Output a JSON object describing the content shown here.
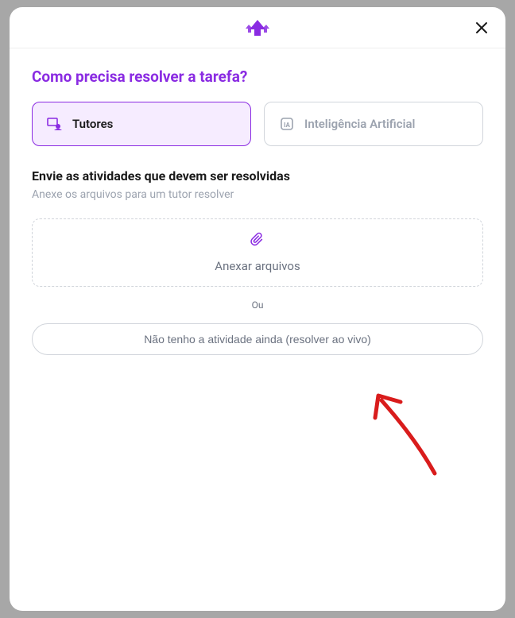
{
  "header": {
    "question": "Como precisa resolver a tarefa?"
  },
  "options": {
    "tutors": {
      "label": "Tutores"
    },
    "ai": {
      "label": "Inteligência Artificial"
    }
  },
  "upload": {
    "title": "Envie as atividades que devem ser resolvidas",
    "subtitle": "Anexe os arquivos para um tutor resolver",
    "dropzone_label": "Anexar arquivos"
  },
  "separator": {
    "label": "Ou"
  },
  "alt_button": {
    "label": "Não tenho a atividade ainda (resolver ao vivo)"
  },
  "colors": {
    "accent": "#8a2be2"
  }
}
